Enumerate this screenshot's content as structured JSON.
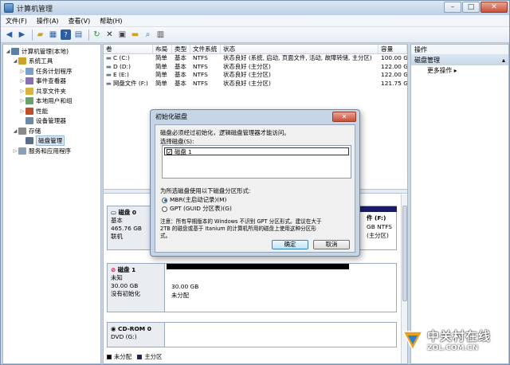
{
  "window": {
    "title": "计算机管理"
  },
  "menu": [
    "文件(F)",
    "操作(A)",
    "查看(V)",
    "帮助(H)"
  ],
  "toolbar_icons": [
    "back-arrow-icon",
    "forward-arrow-icon",
    "up-folder-icon",
    "console-tree-icon",
    "help-icon",
    "properties-icon",
    "refresh-icon",
    "delete-icon",
    "properties-sheet-icon",
    "open-icon",
    "find-icon",
    "disk-icon"
  ],
  "tree": [
    {
      "label": "计算机管理(本地)",
      "level": 0,
      "icon": "computer-icon"
    },
    {
      "label": "系统工具",
      "level": 1,
      "icon": "tools-icon",
      "expanded": true
    },
    {
      "label": "任务计划程序",
      "level": 2,
      "icon": "scheduler-icon"
    },
    {
      "label": "事件查看器",
      "level": 2,
      "icon": "event-icon"
    },
    {
      "label": "共享文件夹",
      "level": 2,
      "icon": "share-icon"
    },
    {
      "label": "本地用户和组",
      "level": 2,
      "icon": "users-icon"
    },
    {
      "label": "性能",
      "level": 2,
      "icon": "performance-icon"
    },
    {
      "label": "设备管理器",
      "level": 2,
      "icon": "device-icon"
    },
    {
      "label": "存储",
      "level": 1,
      "icon": "storage-icon",
      "expanded": true
    },
    {
      "label": "磁盘管理",
      "level": 2,
      "icon": "disk-management-icon",
      "selected": true
    },
    {
      "label": "服务和应用程序",
      "level": 1,
      "icon": "services-icon"
    }
  ],
  "volumes": {
    "headers": [
      "卷",
      "布局",
      "类型",
      "文件系统",
      "状态",
      "容量"
    ],
    "rows": [
      [
        "C (C:)",
        "简单",
        "基本",
        "NTFS",
        "状态良好 (系统, 启动, 页面文件, 活动, 故障转储, 主分区)",
        "100.00 G"
      ],
      [
        "D (D:)",
        "简单",
        "基本",
        "NTFS",
        "状态良好 (主分区)",
        "122.00 G"
      ],
      [
        "E (E:)",
        "简单",
        "基本",
        "NTFS",
        "状态良好 (主分区)",
        "122.00 G"
      ],
      [
        "网盘文件 (F:)",
        "简单",
        "基本",
        "NTFS",
        "状态良好 (主分区)",
        "121.75 G"
      ]
    ]
  },
  "disks": [
    {
      "name": "磁盘 0",
      "type": "基本",
      "size": "465.76 GB",
      "status": "联机",
      "partition_label": "件 (F:)",
      "partition_detail": "GB NTFS",
      "partition_status": "(主分区)"
    },
    {
      "name": "磁盘 1",
      "type": "未知",
      "size": "30.00 GB",
      "status": "没有初始化",
      "partition_size": "30.00 GB",
      "partition_status": "未分配"
    },
    {
      "name": "CD-ROM 0",
      "type": "DVD (G:)"
    }
  ],
  "legend": [
    "未分配",
    "主分区"
  ],
  "legend_colors": [
    "#000000",
    "#1b1b6e"
  ],
  "actions": {
    "header": "操作",
    "section": "磁盘管理",
    "items": [
      "更多操作"
    ]
  },
  "dialog": {
    "title": "初始化磁盘",
    "message": "磁盘必须经过初始化，逻辑磁盘管理器才能访问。",
    "select_label": "选择磁盘(S):",
    "disk_item": "磁盘 1",
    "disk_checked": true,
    "style_label": "为所选磁盘使用以下磁盘分区形式:",
    "options": [
      {
        "label": "MBR(主启动记录)(M)",
        "selected": true
      },
      {
        "label": "GPT (GUID 分区表)(G)",
        "selected": false
      }
    ],
    "note_line1": "注意：所有早期版本的 Windows 不识别 GPT 分区形式。建议在大于",
    "note_line2": "2TB 的磁盘或基于 Itanium 的计算机所用的磁盘上使用这种分区形",
    "note_line3": "式。",
    "ok": "确定",
    "cancel": "取消"
  },
  "watermark": {
    "brand": "中关村在线",
    "url": "ZOL.COM.CN"
  }
}
